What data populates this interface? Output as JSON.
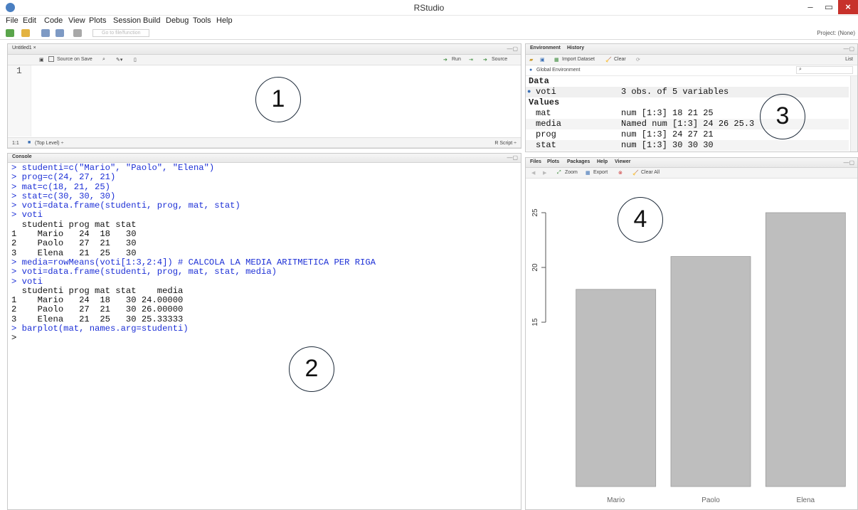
{
  "window": {
    "title": "RStudio",
    "minimize": "–",
    "maximize": "▭",
    "close": "×"
  },
  "menu": [
    "File",
    "Edit",
    "Code",
    "View",
    "Plots",
    "Session",
    "Build",
    "Debug",
    "Tools",
    "Help"
  ],
  "toolbar": {
    "goto_placeholder": "Go to file/function",
    "project": "Project: (None)"
  },
  "editor": {
    "tab": "Untitled1 ×",
    "source_on_save": "Source on Save",
    "run": "Run",
    "source": "Source",
    "line_number": "1",
    "status_pos": "1:1",
    "status_scope": "(Top Level) ÷",
    "status_type": "R Script ÷"
  },
  "console": {
    "tab": "Console",
    "lines": [
      {
        "text": "> studenti=c(\"Mario\", \"Paolo\", \"Elena\")",
        "kind": "cmd"
      },
      {
        "text": "> prog=c(24, 27, 21)",
        "kind": "cmd"
      },
      {
        "text": "> mat=c(18, 21, 25)",
        "kind": "cmd"
      },
      {
        "text": "> stat=c(30, 30, 30)",
        "kind": "cmd"
      },
      {
        "text": "> voti=data.frame(studenti, prog, mat, stat)",
        "kind": "cmd"
      },
      {
        "text": "> voti",
        "kind": "cmd"
      },
      {
        "text": "  studenti prog mat stat",
        "kind": "out"
      },
      {
        "text": "1    Mario   24  18   30",
        "kind": "out"
      },
      {
        "text": "2    Paolo   27  21   30",
        "kind": "out"
      },
      {
        "text": "3    Elena   21  25   30",
        "kind": "out"
      },
      {
        "text": "> media=rowMeans(voti[1:3,2:4]) # CALCOLA LA MEDIA ARITMETICA PER RIGA",
        "kind": "cmd"
      },
      {
        "text": "> voti=data.frame(studenti, prog, mat, stat, media)",
        "kind": "cmd"
      },
      {
        "text": "> voti",
        "kind": "cmd"
      },
      {
        "text": "  studenti prog mat stat    media",
        "kind": "out"
      },
      {
        "text": "1    Mario   24  18   30 24.00000",
        "kind": "out"
      },
      {
        "text": "2    Paolo   27  21   30 26.00000",
        "kind": "out"
      },
      {
        "text": "3    Elena   21  25   30 25.33333",
        "kind": "out"
      },
      {
        "text": "> barplot(mat, names.arg=studenti)",
        "kind": "cmd"
      },
      {
        "text": "> ",
        "kind": "out"
      }
    ]
  },
  "environment": {
    "tabs": [
      "Environment",
      "History"
    ],
    "import_label": "Import Dataset",
    "clear_label": "Clear",
    "list_label": "List",
    "scope": "Global Environment",
    "sections": {
      "data_header": "Data",
      "values_header": "Values"
    },
    "data_rows": [
      {
        "name": "voti",
        "value": "3 obs. of 5 variables"
      }
    ],
    "value_rows": [
      {
        "name": "mat",
        "value": "num [1:3] 18 21 25"
      },
      {
        "name": "media",
        "value": "Named num [1:3] 24 26 25.3"
      },
      {
        "name": "prog",
        "value": "num [1:3] 24 27 21"
      },
      {
        "name": "stat",
        "value": "num [1:3] 30 30 30"
      }
    ]
  },
  "plots": {
    "tabs": [
      "Files",
      "Plots",
      "Packages",
      "Help",
      "Viewer"
    ],
    "zoom": "Zoom",
    "export": "Export",
    "clear_all": "Clear All"
  },
  "chart_data": {
    "type": "bar",
    "categories": [
      "Mario",
      "Paolo",
      "Elena"
    ],
    "values": [
      18,
      21,
      25
    ],
    "ylim": [
      0,
      25
    ],
    "yticks": [
      15,
      20,
      25
    ],
    "bar_color": "#bebebe",
    "title": "",
    "xlabel": "",
    "ylabel": ""
  },
  "annotations": [
    "1",
    "2",
    "3",
    "4"
  ]
}
